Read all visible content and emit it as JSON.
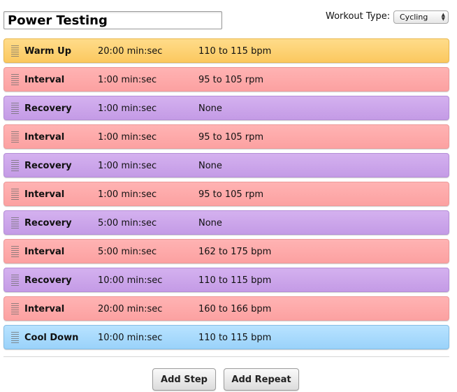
{
  "header": {
    "workout_title": "Power Testing",
    "workout_type_label": "Workout Type:",
    "workout_type_value": "Cycling"
  },
  "colors": {
    "warm_up": "#fbc85f",
    "interval": "#fca1a1",
    "recovery": "#c49be6",
    "cool_down": "#9ad2fa"
  },
  "steps": [
    {
      "type": "warm",
      "name": "Warm Up",
      "duration": "20:00 min:sec",
      "target": "110 to 115 bpm"
    },
    {
      "type": "interval",
      "name": "Interval",
      "duration": "1:00 min:sec",
      "target": "95 to 105 rpm"
    },
    {
      "type": "recovery",
      "name": "Recovery",
      "duration": "1:00 min:sec",
      "target": "None"
    },
    {
      "type": "interval",
      "name": "Interval",
      "duration": "1:00 min:sec",
      "target": "95 to 105 rpm"
    },
    {
      "type": "recovery",
      "name": "Recovery",
      "duration": "1:00 min:sec",
      "target": "None"
    },
    {
      "type": "interval",
      "name": "Interval",
      "duration": "1:00 min:sec",
      "target": "95 to 105 rpm"
    },
    {
      "type": "recovery",
      "name": "Recovery",
      "duration": "5:00 min:sec",
      "target": "None"
    },
    {
      "type": "interval",
      "name": "Interval",
      "duration": "5:00 min:sec",
      "target": "162 to 175 bpm"
    },
    {
      "type": "recovery",
      "name": "Recovery",
      "duration": "10:00 min:sec",
      "target": "110 to 115 bpm"
    },
    {
      "type": "interval",
      "name": "Interval",
      "duration": "20:00 min:sec",
      "target": "160 to 166 bpm"
    },
    {
      "type": "cool",
      "name": "Cool Down",
      "duration": "10:00 min:sec",
      "target": "110 to 115 bpm"
    }
  ],
  "footer": {
    "add_step_label": "Add Step",
    "add_repeat_label": "Add Repeat"
  }
}
